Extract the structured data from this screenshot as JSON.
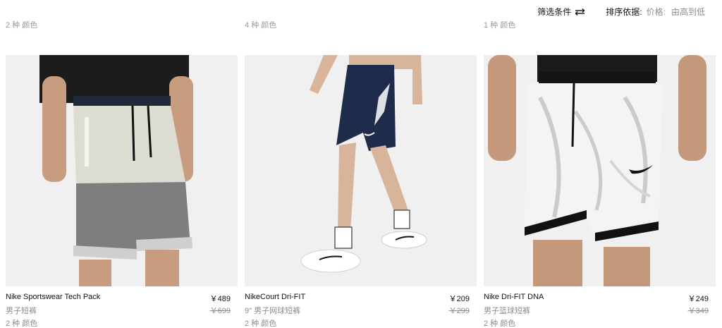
{
  "top_counts": [
    "2 种 颜色",
    "4 种 颜色",
    "1 种 颜色"
  ],
  "toolbar": {
    "filter_label": "筛选条件",
    "filter_icon": "sliders-icon",
    "sort_label": "排序依据:",
    "sort_key": "价格:",
    "sort_value": "由高到低"
  },
  "products": [
    {
      "name": "Nike Sportswear Tech Pack",
      "category": "男子短裤",
      "price": "￥489",
      "original_price": "￥699",
      "colors": "2 种 颜色"
    },
    {
      "name": "NikeCourt Dri-FIT",
      "category": "9\" 男子网球短裤",
      "price": "￥209",
      "original_price": "￥299",
      "colors": "2 种 颜色"
    },
    {
      "name": "Nike Dri-FIT DNA",
      "category": "男子篮球短裤",
      "price": "￥249",
      "original_price": "￥349",
      "colors": "2 种 颜色"
    }
  ]
}
